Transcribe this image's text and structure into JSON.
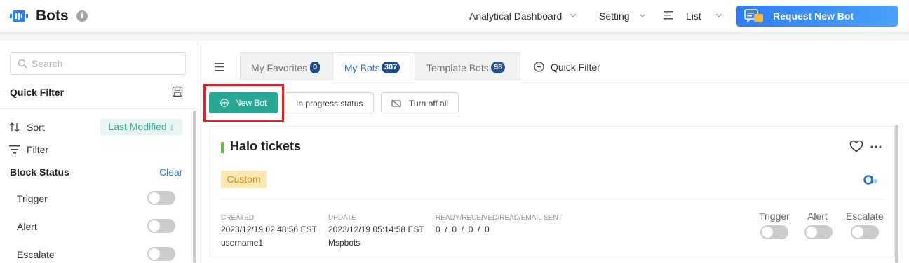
{
  "header": {
    "app_title": "Bots",
    "info_glyph": "i",
    "nav": {
      "analytical_dashboard": "Analytical Dashboard",
      "setting": "Setting",
      "list": "List"
    },
    "request_button": "Request New Bot"
  },
  "sidebar": {
    "search_placeholder": "Search",
    "quick_filter_title": "Quick Filter",
    "sort_label": "Sort",
    "sort_value": "Last Modified ↓",
    "filter_label": "Filter",
    "block_status_title": "Block Status",
    "clear_label": "Clear",
    "toggles": [
      {
        "label": "Trigger",
        "on": false
      },
      {
        "label": "Alert",
        "on": false
      },
      {
        "label": "Escalate",
        "on": false
      }
    ]
  },
  "tabs": [
    {
      "label": "My Favorites",
      "count": "0",
      "active": false
    },
    {
      "label": "My Bots",
      "count": "307",
      "active": true
    },
    {
      "label": "Template Bots",
      "count": "98",
      "active": false
    }
  ],
  "quick_filter_tab": "Quick Filter",
  "toolbar": {
    "new_bot": "New Bot",
    "in_progress": "In progress status",
    "turn_off_all": "Turn off all"
  },
  "card": {
    "title": "Halo tickets",
    "tag": "Custom",
    "created_label": "CREATED",
    "created_value": "2023/12/19 02:48:56 EST",
    "created_by": "username1",
    "update_label": "UPDATE",
    "update_value": "2023/12/19 05:14:58 EST",
    "updated_by": "Mspbots",
    "stats_label": "READY/RECEIVED/READ/EMAIL SENT",
    "stats_value": "0  /  0  /  0  /  0",
    "controls": [
      {
        "label": "Trigger",
        "on": false
      },
      {
        "label": "Alert",
        "on": false
      },
      {
        "label": "Escalate",
        "on": false
      }
    ]
  },
  "colors": {
    "accent_green": "#26a894",
    "primary_blue": "#2f7df6",
    "highlight_red": "#d9262b",
    "tag_bg": "#fde8b4"
  }
}
